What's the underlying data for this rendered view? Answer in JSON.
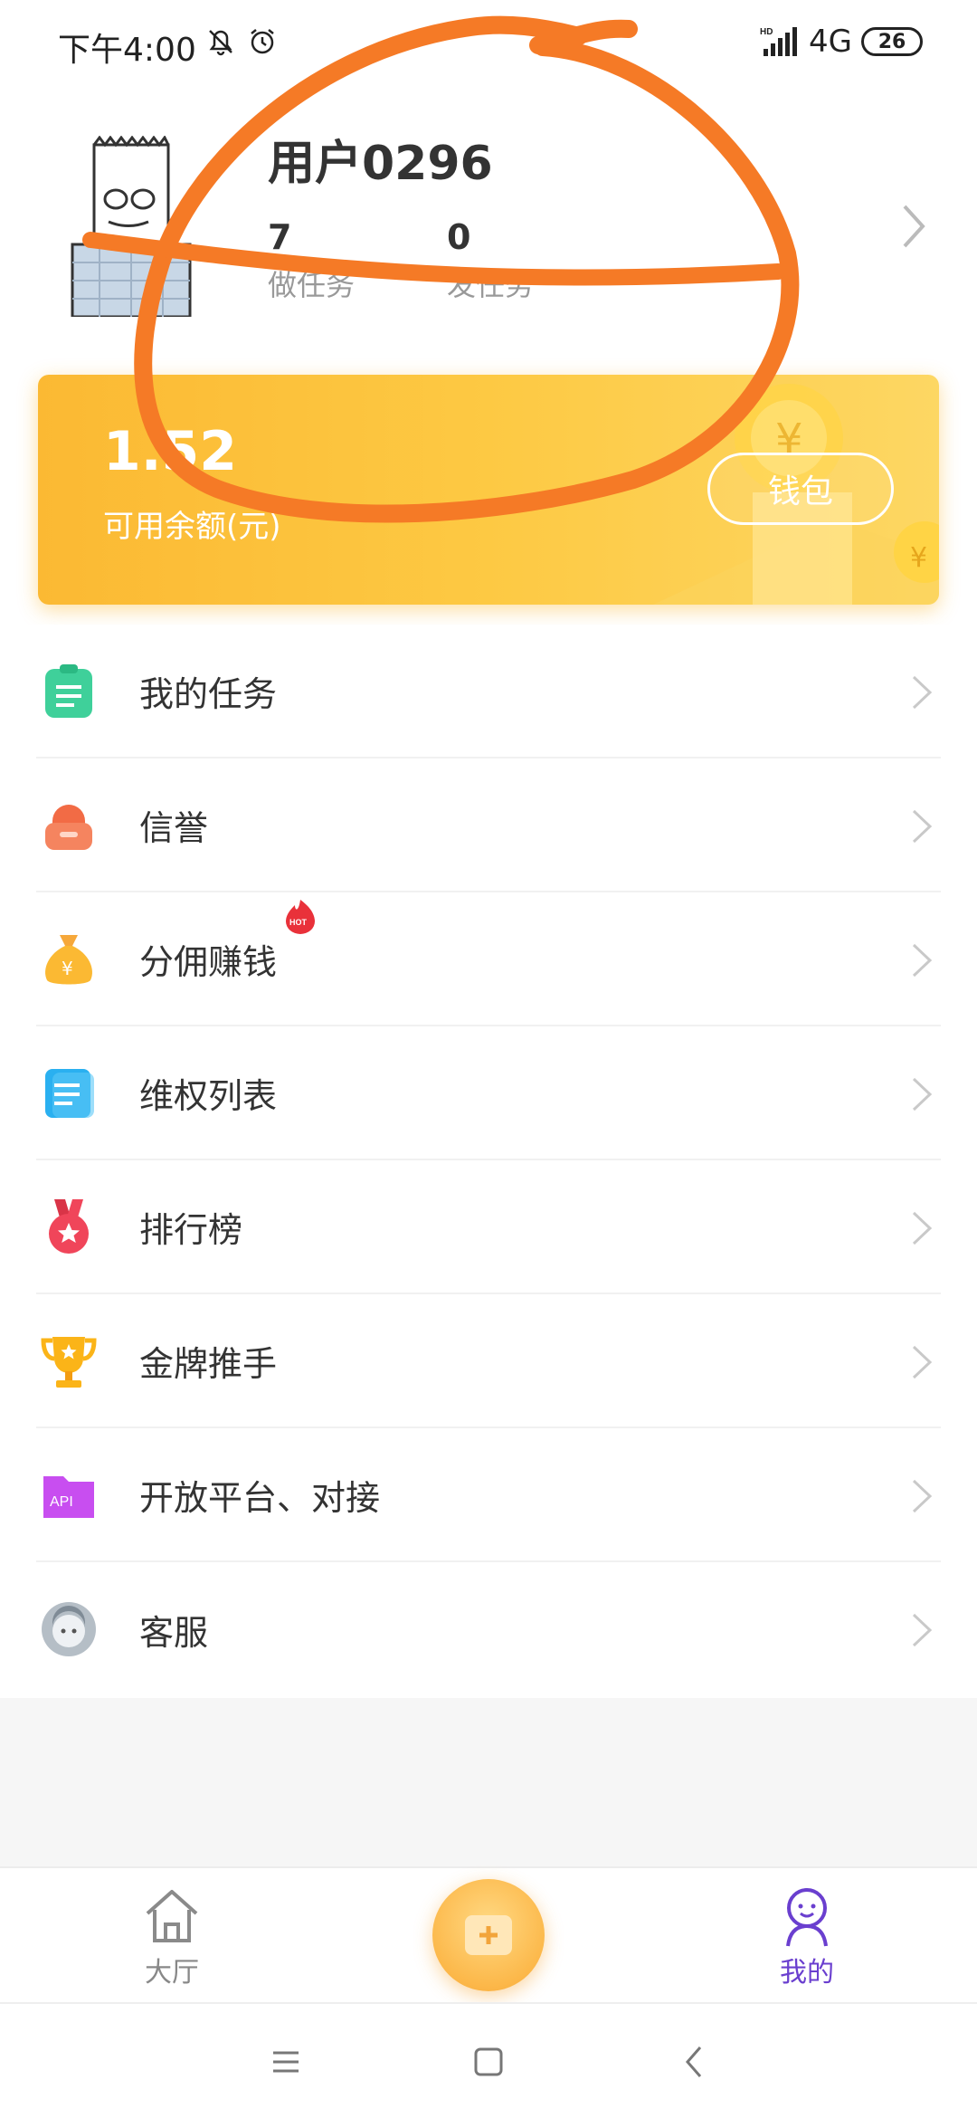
{
  "status_bar": {
    "time": "下午4:00",
    "network": "4G",
    "battery": "26",
    "icons": [
      "bell-off-icon",
      "alarm-icon",
      "hd-signal-icon"
    ]
  },
  "profile": {
    "username": "用户0296",
    "stats": [
      {
        "value": "7",
        "label": "做任务"
      },
      {
        "value": "0",
        "label": "发任务"
      }
    ]
  },
  "balance": {
    "amount": "1.52",
    "label": "可用余额(元)",
    "wallet_button": "钱包"
  },
  "menu": {
    "items": [
      {
        "label": "我的任务",
        "icon": "clipboard-icon",
        "color": "#3fd09a"
      },
      {
        "label": "信誉",
        "icon": "credit-icon",
        "color": "#f26b45"
      },
      {
        "label": "分佣赚钱",
        "icon": "money-bag-icon",
        "color": "#fbb933",
        "badge": "HOT"
      },
      {
        "label": "维权列表",
        "icon": "document-icon",
        "color": "#2ab0f0"
      },
      {
        "label": "排行榜",
        "icon": "medal-icon",
        "color": "#f0455a"
      },
      {
        "label": "金牌推手",
        "icon": "trophy-icon",
        "color": "#fbb418"
      },
      {
        "label": "开放平台、对接",
        "icon": "api-folder-icon",
        "color": "#c84ef0",
        "icon_text": "API"
      },
      {
        "label": "客服",
        "icon": "customer-service-icon",
        "color": "#b5bec6"
      }
    ]
  },
  "tab_bar": {
    "tabs": [
      {
        "label": "大厅",
        "icon": "home-icon"
      },
      {
        "label": "我的",
        "icon": "profile-icon",
        "active": true
      }
    ],
    "center_button": "add-task-icon"
  },
  "colors": {
    "accent_purple": "#6a3fcf",
    "card_yellow": "#fdc943",
    "annotation_orange": "#f57a26"
  }
}
